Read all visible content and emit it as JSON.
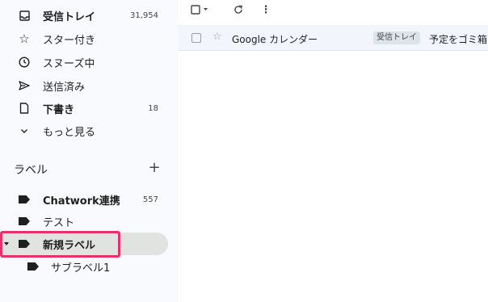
{
  "sidebar": {
    "items": [
      {
        "label": "受信トレイ",
        "count": "31,954",
        "icon": "inbox-icon"
      },
      {
        "label": "スター付き",
        "count": "",
        "icon": "star-icon"
      },
      {
        "label": "スヌーズ中",
        "count": "",
        "icon": "clock-icon"
      },
      {
        "label": "送信済み",
        "count": "",
        "icon": "send-icon"
      },
      {
        "label": "下書き",
        "count": "18",
        "icon": "draft-icon"
      },
      {
        "label": "もっと見る",
        "count": "",
        "icon": "chevron-down-icon"
      }
    ],
    "labels_title": "ラベル",
    "add_label": "+",
    "labels": [
      {
        "label": "Chatwork連携",
        "count": "557"
      },
      {
        "label": "テスト",
        "count": ""
      },
      {
        "label": "新規ラベル",
        "count": ""
      },
      {
        "label": "サブラベル1",
        "count": ""
      }
    ]
  },
  "toolbar": {
    "more_icon": "⋮"
  },
  "mail": {
    "sender": "Google カレンダー",
    "badge": "受信トレイ",
    "subject": "予定をゴミ箱"
  },
  "colors": {
    "highlight": "#e8316b",
    "selected_bg": "#e1e3e1"
  }
}
